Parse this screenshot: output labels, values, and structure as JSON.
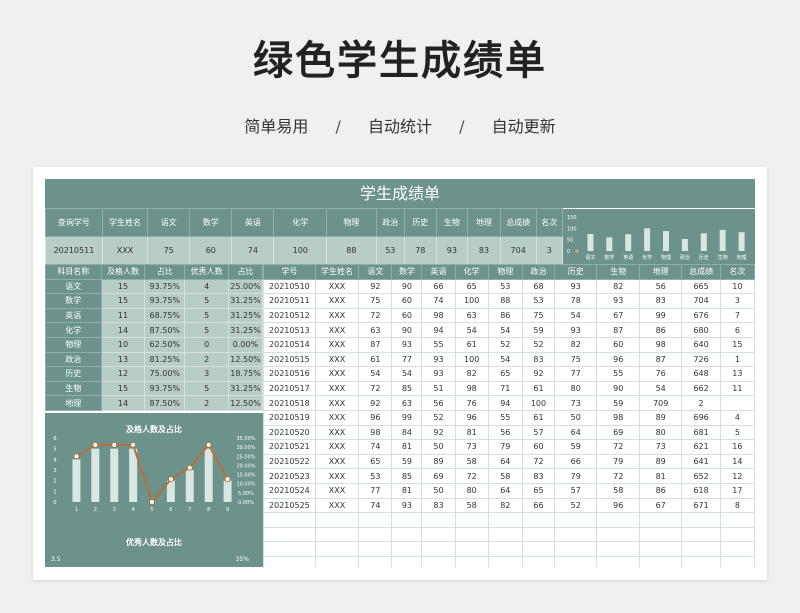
{
  "page": {
    "title": "绿色学生成绩单",
    "subtitle": [
      "简单易用",
      "自动统计",
      "自动更新"
    ],
    "separator": "/"
  },
  "sheet": {
    "header": "学生成绩单"
  },
  "query": {
    "labels": [
      "查询学号",
      "学生姓名",
      "语文",
      "数学",
      "英语",
      "化学",
      "物理",
      "政治",
      "历史",
      "生物",
      "地理",
      "总成绩",
      "名次"
    ],
    "values": [
      "20210511",
      "XXX",
      "75",
      "60",
      "74",
      "100",
      "88",
      "53",
      "78",
      "93",
      "83",
      "704",
      "3"
    ]
  },
  "mini_chart": {
    "categories": [
      "语文",
      "数学",
      "英语",
      "化学",
      "物理",
      "政治",
      "历史",
      "生物",
      "地理"
    ],
    "values": [
      75,
      60,
      74,
      100,
      88,
      53,
      78,
      93,
      83
    ],
    "ymax": 150,
    "yticks": [
      "150",
      "100",
      "50",
      "0"
    ]
  },
  "stats": {
    "headers": [
      "科目名称",
      "及格人数",
      "占比",
      "优秀人数",
      "占比"
    ],
    "rows": [
      [
        "语文",
        "15",
        "93.75%",
        "4",
        "25.00%"
      ],
      [
        "数学",
        "15",
        "93.75%",
        "5",
        "31.25%"
      ],
      [
        "英语",
        "11",
        "68.75%",
        "5",
        "31.25%"
      ],
      [
        "化学",
        "14",
        "87.50%",
        "5",
        "31.25%"
      ],
      [
        "物理",
        "10",
        "62.50%",
        "0",
        "0.00%"
      ],
      [
        "政治",
        "13",
        "81.25%",
        "2",
        "12.50%"
      ],
      [
        "历史",
        "12",
        "75.00%",
        "3",
        "18.75%"
      ],
      [
        "生物",
        "15",
        "93.75%",
        "5",
        "31.25%"
      ],
      [
        "地理",
        "14",
        "87.50%",
        "2",
        "12.50%"
      ]
    ]
  },
  "scores": {
    "headers": [
      "学号",
      "学生姓名",
      "语文",
      "数学",
      "英语",
      "化学",
      "物理",
      "政治",
      "历史",
      "生物",
      "地理",
      "总成绩",
      "名次"
    ],
    "rows": [
      [
        "20210510",
        "XXX",
        "92",
        "90",
        "66",
        "65",
        "53",
        "68",
        "93",
        "82",
        "56",
        "665",
        "10"
      ],
      [
        "20210511",
        "XXX",
        "75",
        "60",
        "74",
        "100",
        "88",
        "53",
        "78",
        "93",
        "83",
        "704",
        "3"
      ],
      [
        "20210512",
        "XXX",
        "72",
        "60",
        "98",
        "63",
        "86",
        "75",
        "54",
        "67",
        "99",
        "676",
        "7"
      ],
      [
        "20210513",
        "XXX",
        "63",
        "90",
        "94",
        "54",
        "54",
        "59",
        "93",
        "87",
        "86",
        "680",
        "6"
      ],
      [
        "20210514",
        "XXX",
        "87",
        "93",
        "55",
        "61",
        "52",
        "52",
        "82",
        "60",
        "98",
        "640",
        "15"
      ],
      [
        "20210515",
        "XXX",
        "61",
        "77",
        "93",
        "100",
        "54",
        "83",
        "75",
        "96",
        "87",
        "726",
        "1"
      ],
      [
        "20210516",
        "XXX",
        "54",
        "54",
        "93",
        "82",
        "65",
        "92",
        "77",
        "55",
        "76",
        "648",
        "13"
      ],
      [
        "20210517",
        "XXX",
        "72",
        "85",
        "51",
        "98",
        "71",
        "61",
        "80",
        "90",
        "54",
        "662",
        "11"
      ],
      [
        "20210518",
        "XXX",
        "92",
        "63",
        "56",
        "76",
        "94",
        "100",
        "73",
        "59",
        "709",
        "2"
      ],
      [
        "20210519",
        "XXX",
        "96",
        "99",
        "52",
        "96",
        "55",
        "61",
        "50",
        "98",
        "89",
        "696",
        "4"
      ],
      [
        "20210520",
        "XXX",
        "98",
        "84",
        "92",
        "81",
        "56",
        "57",
        "64",
        "69",
        "80",
        "681",
        "5"
      ],
      [
        "20210521",
        "XXX",
        "74",
        "81",
        "50",
        "73",
        "79",
        "60",
        "59",
        "72",
        "73",
        "621",
        "16"
      ],
      [
        "20210522",
        "XXX",
        "65",
        "59",
        "89",
        "58",
        "64",
        "72",
        "66",
        "79",
        "89",
        "641",
        "14"
      ],
      [
        "20210523",
        "XXX",
        "53",
        "85",
        "69",
        "72",
        "58",
        "83",
        "79",
        "72",
        "81",
        "652",
        "12"
      ],
      [
        "20210524",
        "XXX",
        "77",
        "81",
        "50",
        "80",
        "64",
        "65",
        "57",
        "58",
        "86",
        "618",
        "17"
      ],
      [
        "20210525",
        "XXX",
        "74",
        "93",
        "83",
        "58",
        "82",
        "66",
        "52",
        "96",
        "67",
        "671",
        "8"
      ]
    ],
    "empty_rows": 4
  },
  "chart_data": [
    {
      "type": "bar",
      "title": "及格人数及占比",
      "categories": [
        "1",
        "2",
        "3",
        "4",
        "5",
        "6",
        "7",
        "8",
        "9"
      ],
      "series": [
        {
          "values": [
            4,
            5,
            5,
            5,
            0,
            2,
            3,
            5,
            2
          ]
        },
        {
          "values": [
            25.0,
            31.25,
            31.25,
            31.25,
            0.0,
            12.5,
            18.75,
            31.25,
            12.5
          ]
        }
      ],
      "ylim": [
        0,
        6
      ],
      "yticks": [
        "6",
        "5",
        "4",
        "3",
        "2",
        "1",
        "0"
      ],
      "y2ticks": [
        "35.00%",
        "30.00%",
        "25.00%",
        "20.00%",
        "15.00%",
        "10.00%",
        "5.00%",
        "0.00%"
      ],
      "colors": {
        "bar": "#d9e6e2",
        "line": "#b5713c"
      }
    },
    {
      "type": "bar",
      "title": "优秀人数及占比",
      "corner_left": "3.5",
      "corner_right": "35%"
    }
  ]
}
